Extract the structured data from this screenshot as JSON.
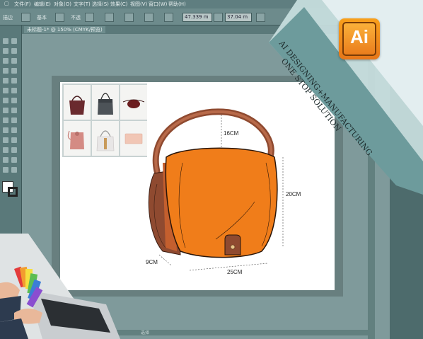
{
  "menu": {
    "items": [
      "文件(F)",
      "编辑(E)",
      "对象(O)",
      "文字(T)",
      "选择(S)",
      "效果(C)",
      "视图(V)",
      "窗口(W)",
      "帮助(H)"
    ]
  },
  "toolbar": {
    "label_left": "描边",
    "label_2": "基本",
    "label_3": "不透",
    "w_value": "47.339 m",
    "h_value": "37.04 m"
  },
  "document": {
    "tab_label": "未标题-1* @ 150% (CMYK/预览)"
  },
  "statusbar": {
    "label": "选择"
  },
  "banner": {
    "line1": "AI DESIGNING+MANUFACTURING",
    "line2": "ONE STOP SOLUTION",
    "logo_text": "Ai",
    "colors": {
      "banner_bg": "#d3e5e6",
      "banner_text": "#2a3f40",
      "logo_orange": "#f39a1f"
    }
  },
  "dimensions": {
    "height_top": "16CM",
    "height_body": "20CM",
    "width": "25CM",
    "depth": "9CM"
  },
  "colors": {
    "bag_flap": "#f07d1a",
    "bag_side": "#8f4a30",
    "bag_strap": "#a35a3e"
  }
}
